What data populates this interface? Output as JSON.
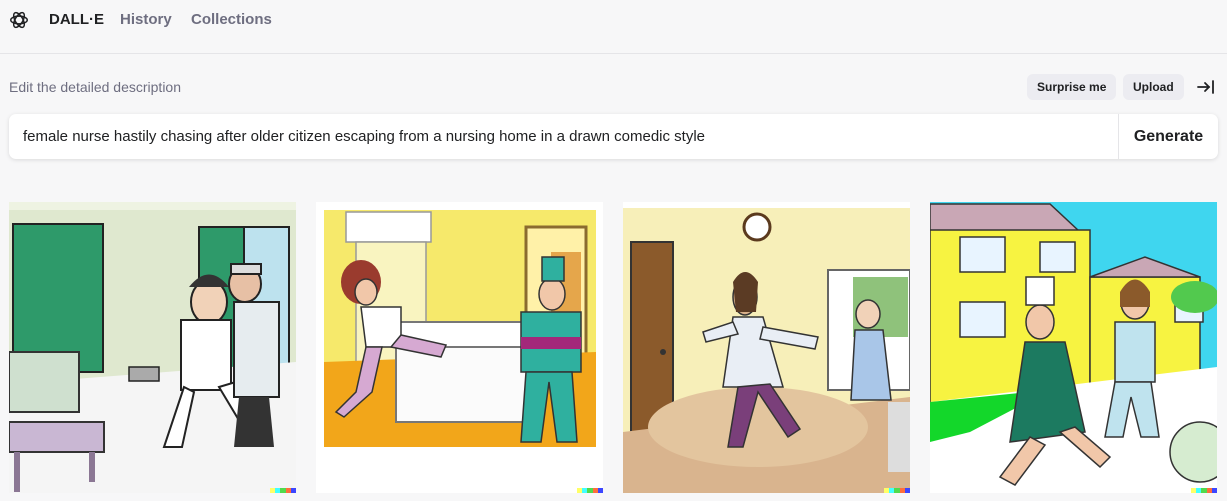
{
  "header": {
    "brand": "DALL·E",
    "nav": [
      "History",
      "Collections"
    ]
  },
  "editor": {
    "label": "Edit the detailed description",
    "surprise_label": "Surprise me",
    "upload_label": "Upload",
    "prompt": "female nurse hastily chasing after older citizen escaping from a nursing home in a drawn comedic style",
    "generate_label": "Generate"
  },
  "results": [
    {
      "id": 1,
      "icon": "generated-image"
    },
    {
      "id": 2,
      "icon": "generated-image"
    },
    {
      "id": 3,
      "icon": "generated-image"
    },
    {
      "id": 4,
      "icon": "generated-image"
    }
  ],
  "colors": {
    "accent_text": "#202123",
    "muted_text": "#6e6e80",
    "pill_bg": "#ececf1",
    "watermark": [
      "#ffff66",
      "#42ffff",
      "#51da4c",
      "#ff6e3c",
      "#3c46ff"
    ]
  }
}
